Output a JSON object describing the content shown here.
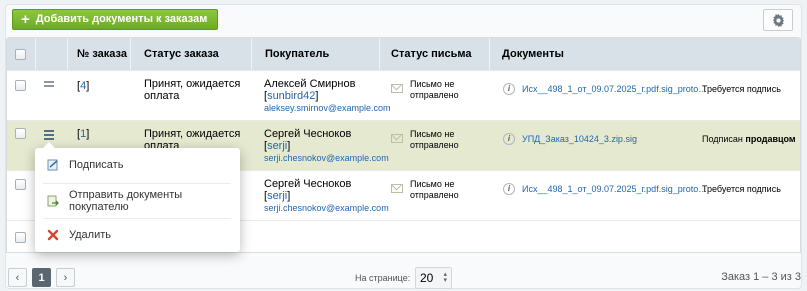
{
  "toolbar": {
    "add_label": "Добавить документы к заказам",
    "settings_icon": "gear-icon"
  },
  "table": {
    "headers": {
      "number": "№ заказа",
      "status": "Статус заказа",
      "buyer": "Покупатель",
      "letter": "Статус письма",
      "docs": "Документы"
    },
    "rows": [
      {
        "number": "4",
        "status": "Принят, ожидается оплата",
        "buyer_name": "Алексей Смирнов",
        "buyer_login": "sunbird42",
        "buyer_email": "aleksey.smirnov@example.com",
        "letter": "Письмо не отправлено",
        "doc_name": "Исх__498_1_от_09.07.2025_г.pdf.sig_proto…",
        "doc_status": "Требуется подпись",
        "doc_status_bold": ""
      },
      {
        "number": "1",
        "status": "Принят, ожидается оплата",
        "buyer_name": "Сергей Чесноков",
        "buyer_login": "serji",
        "buyer_email": "serji.chesnokov@example.com",
        "letter": "Письмо не отправлено",
        "doc_name": "УПД_Заказ_10424_3.zip.sig",
        "doc_status": "Подписан",
        "doc_status_bold": "продавцом"
      },
      {
        "number": "",
        "status": "",
        "buyer_name": "Сергей Чесноков",
        "buyer_login": "serji",
        "buyer_email": "serji.chesnokov@example.com",
        "letter": "Письмо не отправлено",
        "doc_name": "Исх__498_1_от_09.07.2025_г.pdf.sig_proto…",
        "doc_status": "Требуется подпись",
        "doc_status_bold": ""
      }
    ]
  },
  "context_menu": {
    "items": [
      {
        "label": "Подписать",
        "icon": "sign-icon"
      },
      {
        "label": "Отправить документы покупателю",
        "icon": "send-document-icon"
      },
      {
        "label": "Удалить",
        "icon": "delete-icon"
      }
    ]
  },
  "pagination": {
    "current_page": "1",
    "per_page_label": "На странице:",
    "per_page_value": "20",
    "summary": "Заказ 1 – 3 из 3"
  },
  "colors": {
    "accent": "#6eab24",
    "selected_row": "#e5e9d0",
    "link": "#2067b0",
    "header_bg": "#d7e1e7"
  }
}
